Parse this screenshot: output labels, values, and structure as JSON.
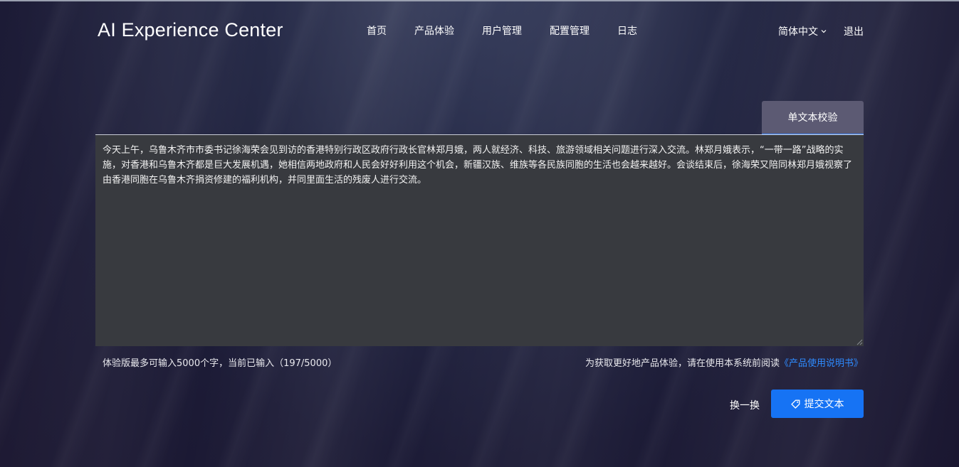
{
  "header": {
    "logo": "AI Experience Center",
    "nav": [
      "首页",
      "产品体验",
      "用户管理",
      "配置管理",
      "日志"
    ],
    "language": "简体中文",
    "logout": "退出"
  },
  "tabs": {
    "active_label": "单文本校验"
  },
  "editor": {
    "text": "今天上午，乌鲁木齐市市委书记徐海荣会见到访的香港特别行政区政府行政长官林郑月娥，两人就经济、科技、旅游领域相关问题进行深入交流。林郑月娥表示，“一带一路”战略的实施，对香港和乌鲁木齐都是巨大发展机遇，她相信两地政府和人民会好好利用这个机会，新疆汉族、维族等各民族同胞的生活也会越来越好。会谈结束后，徐海荣又陪同林郑月娥视察了由香港同胞在乌鲁木齐捐资修建的福利机构，并同里面生活的残废人进行交流。",
    "counter_text": "体验版最多可输入5000个字，当前已输入（197/5000）",
    "hint_prefix": "为获取更好地产品体验，请在使用本系统前阅读",
    "manual_link": "《产品使用说明书》"
  },
  "actions": {
    "swap_label": "换一换",
    "submit_label": "提交文本"
  },
  "colors": {
    "accent": "#1673f4",
    "link": "#2e8bff",
    "tab_bg": "#5c5a73",
    "textarea_bg": "#383a3f"
  },
  "icons": {
    "submit": "tag-icon",
    "language": "chevron-down-icon"
  }
}
